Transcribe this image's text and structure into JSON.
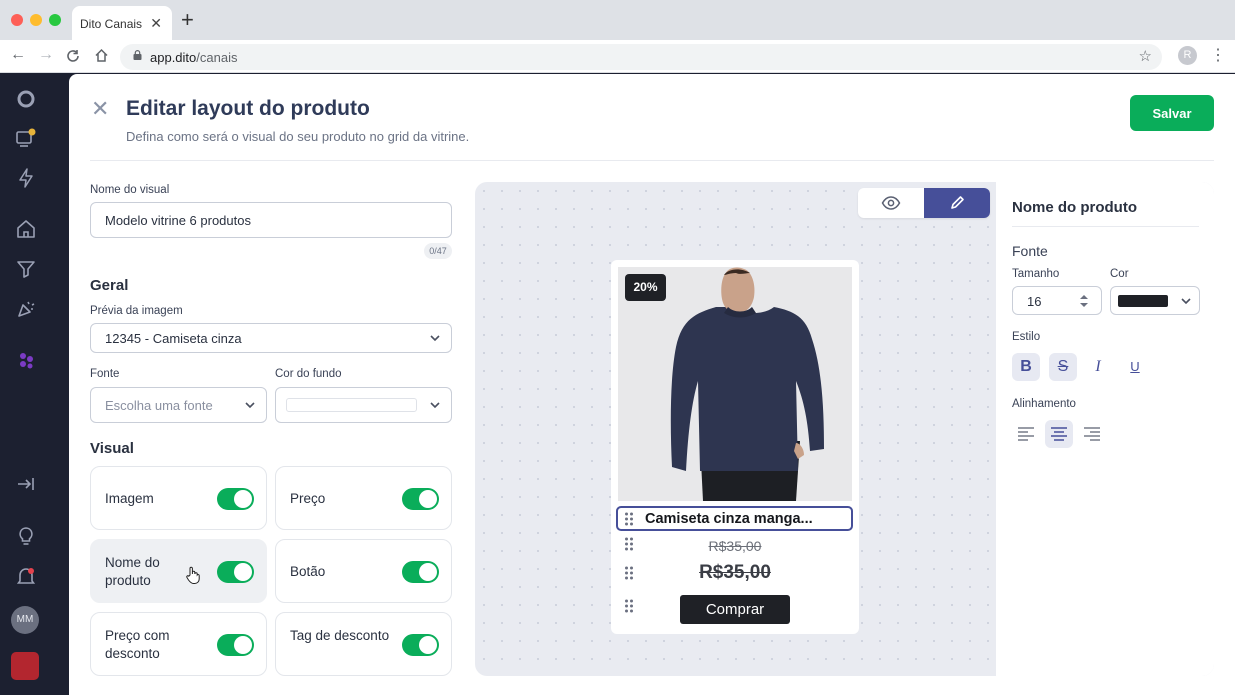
{
  "browser": {
    "tab_title": "Dito Canais",
    "tab_close": "✕",
    "new_tab": "+",
    "url_host": "app.dito",
    "url_path": "/canais",
    "profile_initial": "R"
  },
  "rail": {
    "avatar_initials": "MM"
  },
  "header": {
    "title": "Editar layout do produto",
    "subtitle": "Defina como será o visual do seu produto no grid da vitrine.",
    "save_label": "Salvar"
  },
  "form": {
    "visual_name_label": "Nome do visual",
    "visual_name_value": "Modelo vitrine 6 produtos",
    "visual_name_counter": "0/47",
    "general_title": "Geral",
    "image_preview_label": "Prévia da imagem",
    "image_preview_value": "12345 - Camiseta cinza",
    "font_label": "Fonte",
    "font_placeholder": "Escolha uma fonte",
    "bg_color_label": "Cor do fundo",
    "visual_title": "Visual",
    "toggles": [
      {
        "label": "Imagem",
        "on": true
      },
      {
        "label": "Preço",
        "on": true
      },
      {
        "label": "Nome do produto",
        "on": true
      },
      {
        "label": "Botão",
        "on": true
      },
      {
        "label": "Preço com desconto",
        "on": true
      },
      {
        "label": "Tag de desconto",
        "on": true
      }
    ]
  },
  "preview": {
    "discount_badge": "20%",
    "product_name": "Camiseta cinza manga...",
    "old_price": "R$35,00",
    "new_price": "R$35,00",
    "buy_label": "Comprar"
  },
  "props": {
    "title": "Nome do produto",
    "font_section": "Fonte",
    "size_label": "Tamanho",
    "size_value": "16",
    "color_label": "Cor",
    "color_value": "#1f2126",
    "style_label": "Estilo",
    "style_bold": "B",
    "style_strike": "S",
    "style_italic": "I",
    "style_underline": "U",
    "align_label": "Alinhamento"
  },
  "colors": {
    "accent": "#464f99",
    "save_green": "#0aad5a",
    "toggle_on": "#0aad5a"
  }
}
